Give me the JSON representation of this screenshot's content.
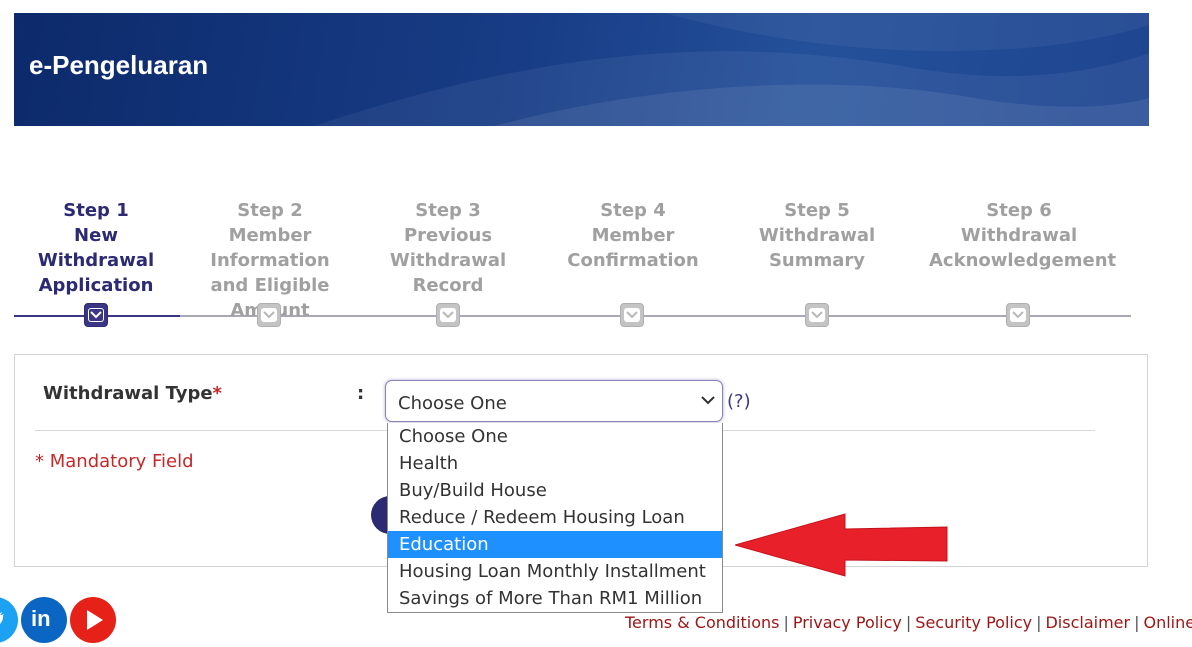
{
  "app": {
    "title": "e-Pengeluaran"
  },
  "steps": [
    {
      "label": "Step 1",
      "title": "New Withdrawal Application",
      "active": true
    },
    {
      "label": "Step 2",
      "title": "Member Information and Eligible Amount",
      "active": false
    },
    {
      "label": "Step 3",
      "title": "Previous Withdrawal Record",
      "active": false
    },
    {
      "label": "Step 4",
      "title": "Member Confirmation",
      "active": false
    },
    {
      "label": "Step 5",
      "title": "Withdrawal Summary",
      "active": false
    },
    {
      "label": "Step 6",
      "title": "Withdrawal Acknowledgement",
      "active": false
    }
  ],
  "form": {
    "withdrawal_type_label": "Withdrawal Type",
    "required_marker": "*",
    "colon": ":",
    "selected_value": "Choose One",
    "help_text": "(?)",
    "mandatory_note": "* Mandatory Field"
  },
  "dropdown": {
    "options": [
      "Choose One",
      "Health",
      "Buy/Build House",
      "Reduce / Redeem Housing Loan",
      "Education",
      "Housing Loan Monthly Installment",
      "Savings of More Than RM1 Million"
    ],
    "highlighted": "Education"
  },
  "footer": {
    "links": [
      "Terms & Conditions",
      "Privacy Policy",
      "Security Policy",
      "Disclaimer",
      "Online Securi"
    ],
    "separator": "|"
  },
  "social": {
    "icons": [
      "twitter-icon",
      "linkedin-icon",
      "youtube-icon"
    ],
    "linkedin_text": "in"
  },
  "colors": {
    "primary": "#2b2a72",
    "highlight": "#1e90ff",
    "required": "#c62828",
    "arrow": "#e8202a",
    "link": "#9c1515"
  }
}
